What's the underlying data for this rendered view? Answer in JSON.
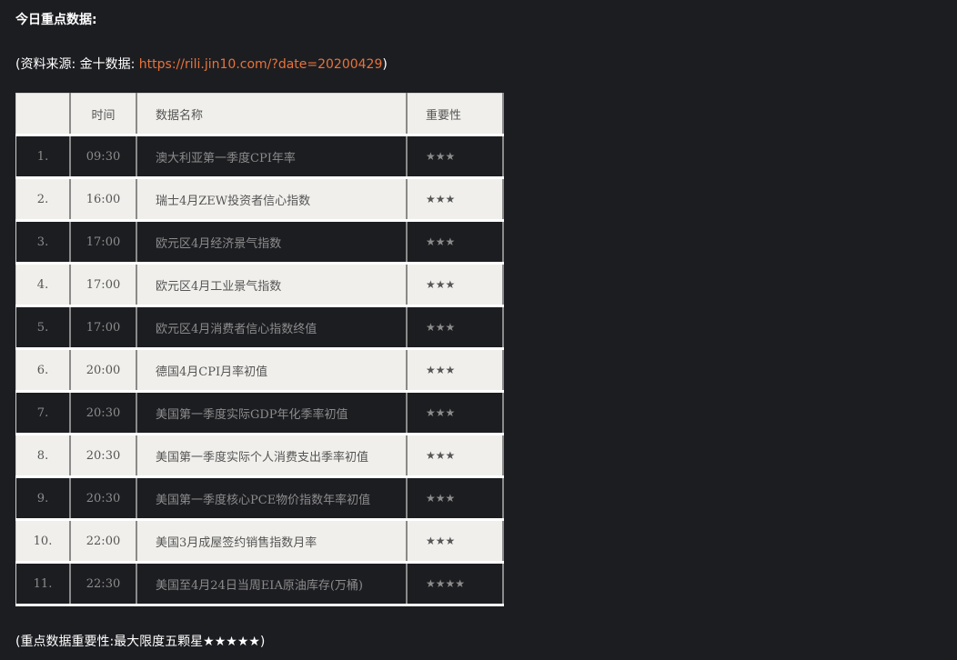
{
  "heading": "今日重点数据:",
  "source": {
    "prefix": "(资料来源: 金十数据: ",
    "link": "https://rili.jin10.com/?date=20200429",
    "suffix": ")"
  },
  "table": {
    "headers": [
      "",
      "时间",
      "数据名称",
      "重要性"
    ],
    "rows": [
      {
        "num": "1.",
        "time": "09:30",
        "name": "澳大利亚第一季度CPI年率",
        "stars": "★★★"
      },
      {
        "num": "2.",
        "time": "16:00",
        "name": "瑞士4月ZEW投资者信心指数",
        "stars": "★★★"
      },
      {
        "num": "3.",
        "time": "17:00",
        "name": "欧元区4月经济景气指数",
        "stars": "★★★"
      },
      {
        "num": "4.",
        "time": "17:00",
        "name": "欧元区4月工业景气指数",
        "stars": "★★★"
      },
      {
        "num": "5.",
        "time": "17:00",
        "name": "欧元区4月消费者信心指数终值",
        "stars": "★★★"
      },
      {
        "num": "6.",
        "time": "20:00",
        "name": "德国4月CPI月率初值",
        "stars": "★★★"
      },
      {
        "num": "7.",
        "time": "20:30",
        "name": "美国第一季度实际GDP年化季率初值",
        "stars": "★★★"
      },
      {
        "num": "8.",
        "time": "20:30",
        "name": "美国第一季度实际个人消费支出季率初值",
        "stars": "★★★"
      },
      {
        "num": "9.",
        "time": "20:30",
        "name": "美国第一季度核心PCE物价指数年率初值",
        "stars": "★★★"
      },
      {
        "num": "10.",
        "time": "22:00",
        "name": "美国3月成屋签约销售指数月率",
        "stars": "★★★"
      },
      {
        "num": "11.",
        "time": "22:30",
        "name": "美国至4月24日当周EIA原油库存(万桶)",
        "stars": "★★★★"
      }
    ]
  },
  "footnote": "(重点数据重要性:最大限度五颗星★★★★★)"
}
